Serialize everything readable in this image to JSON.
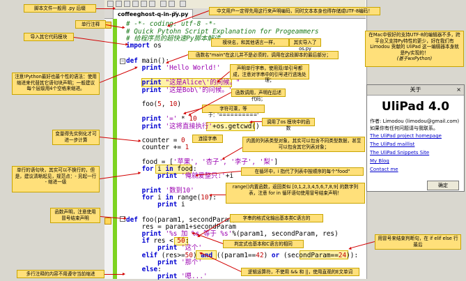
{
  "tab": {
    "title": "coffeeghost-q-in-py.py",
    "close": "×"
  },
  "code": {
    "l1": "# -*- coding: utf-8 -*-",
    "l2": "# Quick Pytohn Script Explanation for Progeammers",
    "l3": "# 给程序员的超快速Py脚本解读",
    "l4a": "import",
    "l4b": " os",
    "l5a": "def",
    "l5b": " main():",
    "l6a": "    print",
    "l6b": " 'Hello World!'",
    "l7a": "    print",
    "l7b": " \"这是Alice\\'的问候。\"",
    "l8a": "    print",
    "l8b": " '这是Bob\\'的问候。'",
    "l9a": "    foo(",
    "l9b": "5",
    "l9c": ", ",
    "l9d": "10",
    "l9e": ")",
    "l10a": "    print",
    "l10b": " '=' ",
    "l10c": "* ",
    "l10d": "10",
    "l11a": "    print",
    "l11b": " '这将直接执行'",
    "l11c": "+os.getcwd()",
    "l12a": "    counter = ",
    "l12b": "0",
    "l13a": "    counter += ",
    "l13b": "1",
    "l14a": "    food = [",
    "l14b": "'苹果', '杏子', '李子', '梨'",
    "l14c": "]",
    "l15a": "    for",
    "l15b": " i ",
    "l15c": "in",
    "l15d": " food:",
    "l16a": "        print",
    "l16b": " '俺就爱整只:'",
    "l16c": "+i",
    "l17a": "    print",
    "l17b": " '数到10'",
    "l18a": "    for",
    "l18b": " i ",
    "l18c": "in",
    "l18d": " range(",
    "l18e": "10",
    "l18f": "):",
    "l19a": "        print",
    "l19b": " i",
    "l20a": "def",
    "l20b": " foo(param1, secondParam):",
    "l21": "    res = param1+secondParam",
    "l22a": "    print",
    "l22b": " '%s 加 %s 等于 %s'",
    "l22c": "%(param1, secondParam, res)",
    "l23a": "    if",
    "l23b": " res < ",
    "l23c": "50",
    "l23d": ":",
    "l24a": "        print",
    "l24b": " '这个'",
    "l25a": "    elif",
    "l25b": " (res>=",
    "l25c": "50",
    "l25d": ") ",
    "l25e": "and",
    "l25f": " ((param1==",
    "l25g": "42",
    "l25h": ") ",
    "l25i": "or",
    "l25j": " (secondParam==",
    "l25k": "24",
    "l25l": ")):",
    "l26a": "        print",
    "l26b": " '那个'",
    "l27a": "    else",
    "l27b": ":",
    "l28a": "        print",
    "l28b": " '嗯...'"
  },
  "notes": {
    "header": "脚本文件一般用 .py 后缀",
    "top": "中文用户一定得先用这行来声明编码，同时文本本身也得存储成UTF-8编码！",
    "single": "单行注释",
    "module": "模块名，和其他语言一样，",
    "module2": "导入其它代码模块",
    "module3": "其实导入了 os.py",
    "main": "函数名\"main\"在这儿并不是必须的，调用在这段脚本的最后部分；",
    "indent": "注意!Python最好也最个性的语法：使用缩进来代替其它语句块声明；一般建议每个层级用4个空格来缩进。",
    "str": "声明单行字串，使用双/单引号都成，注意对字串中的引号进行逃逸处理；",
    "call": "函数调用，声明在后述代码；",
    "mult": "字符可乘，等于：'=========='",
    "osfn": "调用了os 模块中的函数",
    "concat": "连接字串",
    "var": "变量得先实例化才可进一步计算",
    "list": "内置的列表类型对象，其实可以包含不同类型数据，甚至可以包含其它列表对象；",
    "for": "单行的语句块，其实可以不换行的，但是，建议清晰起见，规范点：- 另起一行 - 缩进一级",
    "loop": "在循环中，i 指代了列表中按顺序的每个\"food\"",
    "range": "range()内置函数，返回类似 [0,1,2,3,4,5,6,7,8,9] 的数字列表，注意 for in 循环语句使用冒号结束声明！",
    "func": "函数声明，注意使用冒号结束声明",
    "fmt": "字串的格式化输出基本类C语言的",
    "cmp": "判定式也基本和C语言的相同",
    "if": "用冒号来结束判断句，在 if elif else 行最后",
    "logic": "逻辑运算符，不使用 && 和 ||，使用直观的E文单词",
    "multi": "多行注释的内容不用遵守当前缩进",
    "mac": "在Mac中很好的支持UTF-8的编辑器不多，跨平台又支持Py特性的更少，好在我们有 Limodou 贡献的 UliPad 这一编辑器本身就是Py实现的！",
    "mac2": "(基于wxPython)"
  },
  "about": {
    "title": "关于",
    "close": "×",
    "name": "UliPad 4.0",
    "author": "作者: Limodou (limodou@gmail.com)",
    "feedback": "如果你有任何问题请与我联系。",
    "links": [
      "The UliPad project homepage",
      "The UliPad maillist",
      "The UliPad Snippets Site",
      "My Blog",
      "Contact me"
    ],
    "ok": "确定"
  }
}
